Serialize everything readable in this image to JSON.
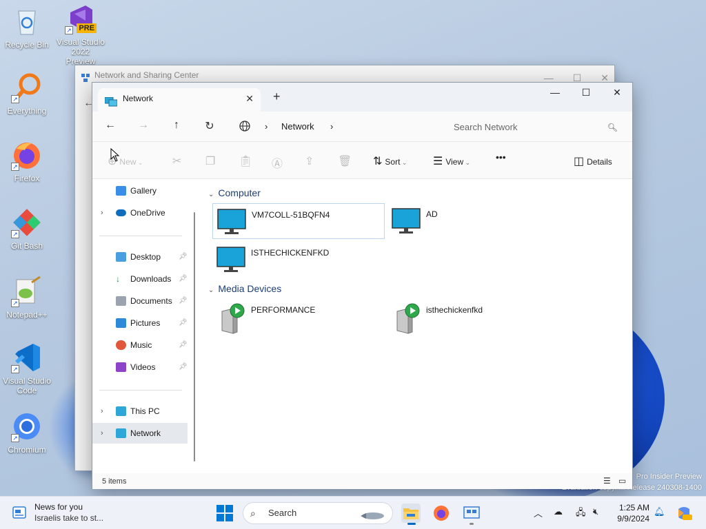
{
  "desktop": {
    "icons": [
      {
        "label": "Recycle Bin"
      },
      {
        "label": "Visual Studio 2022 Preview",
        "badge": "PRE"
      },
      {
        "label": "Everything"
      },
      {
        "label": "Firefox"
      },
      {
        "label": "Git Bash"
      },
      {
        "label": "Notepad++"
      },
      {
        "label": "Visual Studio Code"
      },
      {
        "label": "Chromium"
      }
    ],
    "watermark": {
      "line1": "Pro Insider Preview",
      "line2": "Evaluation copy. ... Release 240308-1400"
    }
  },
  "background_window": {
    "title": "Network and Sharing Center"
  },
  "explorer": {
    "tab_title": "Network",
    "address": {
      "location": "Network",
      "search_placeholder": "Search Network"
    },
    "commands": {
      "new": "New",
      "sort": "Sort",
      "view": "View",
      "more": "•••",
      "details": "Details"
    },
    "sidebar": {
      "items": [
        {
          "label": "Gallery"
        },
        {
          "label": "OneDrive"
        },
        {
          "label": "Desktop"
        },
        {
          "label": "Downloads"
        },
        {
          "label": "Documents"
        },
        {
          "label": "Pictures"
        },
        {
          "label": "Music"
        },
        {
          "label": "Videos"
        },
        {
          "label": "This PC"
        },
        {
          "label": "Network"
        }
      ]
    },
    "groups": [
      {
        "title": "Computer",
        "items": [
          "VM7COLL-51BQFN4",
          "AD",
          "ISTHECHICKENFKD"
        ]
      },
      {
        "title": "Media Devices",
        "items": [
          "PERFORMANCE",
          "isthechickenfkd"
        ]
      }
    ],
    "status": {
      "count": "5 items"
    }
  },
  "taskbar": {
    "news_title": "News for you",
    "news_subtitle": "Israelis take to st...",
    "search_label": "Search",
    "time": "1:25 AM",
    "date": "9/9/2024"
  },
  "colors": {
    "accent": "#0067c0",
    "monitor_screen": "#1aa3d9",
    "media_play": "#2ea84a"
  }
}
